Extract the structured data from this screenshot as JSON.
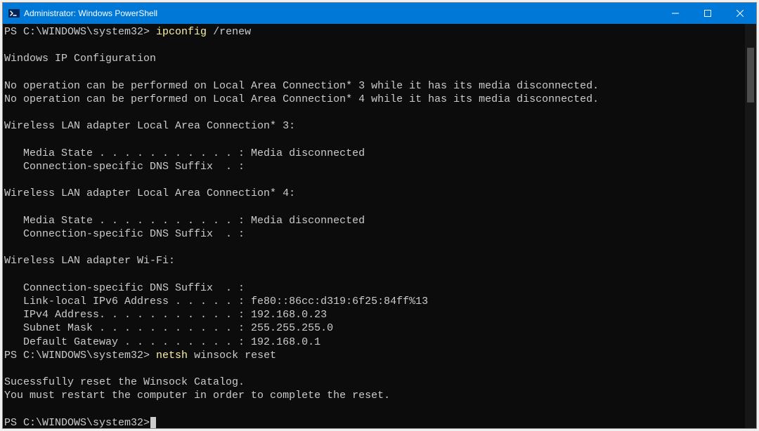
{
  "window": {
    "title": "Administrator: Windows PowerShell"
  },
  "terminal": {
    "prompt1": "PS C:\\WINDOWS\\system32> ",
    "cmd1a": "ipconfig ",
    "cmd1b": "/renew",
    "header": "Windows IP Configuration",
    "noop1": "No operation can be performed on Local Area Connection* 3 while it has its media disconnected.",
    "noop2": "No operation can be performed on Local Area Connection* 4 while it has its media disconnected.",
    "adapter3_title": "Wireless LAN adapter Local Area Connection* 3:",
    "adapter3_media": "   Media State . . . . . . . . . . . : Media disconnected",
    "adapter3_suffix": "   Connection-specific DNS Suffix  . :",
    "adapter4_title": "Wireless LAN adapter Local Area Connection* 4:",
    "adapter4_media": "   Media State . . . . . . . . . . . : Media disconnected",
    "adapter4_suffix": "   Connection-specific DNS Suffix  . :",
    "wifi_title": "Wireless LAN adapter Wi-Fi:",
    "wifi_suffix": "   Connection-specific DNS Suffix  . :",
    "wifi_ipv6": "   Link-local IPv6 Address . . . . . : fe80::86cc:d319:6f25:84ff%13",
    "wifi_ipv4": "   IPv4 Address. . . . . . . . . . . : 192.168.0.23",
    "wifi_subnet": "   Subnet Mask . . . . . . . . . . . : 255.255.255.0",
    "wifi_gw": "   Default Gateway . . . . . . . . . : 192.168.0.1",
    "prompt2": "PS C:\\WINDOWS\\system32> ",
    "cmd2a": "netsh ",
    "cmd2b": "winsock reset",
    "winsock1": "Sucessfully reset the Winsock Catalog.",
    "winsock2": "You must restart the computer in order to complete the reset.",
    "prompt3": "PS C:\\WINDOWS\\system32>"
  }
}
